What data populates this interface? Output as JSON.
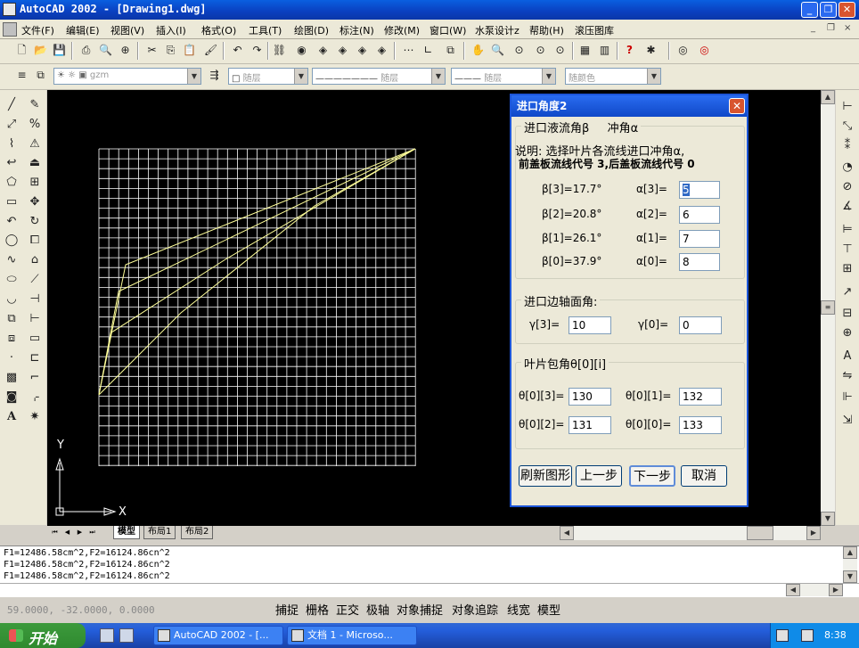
{
  "window": {
    "title": "AutoCAD 2002 - [Drawing1.dwg]",
    "minimize": "_",
    "restore": "❐",
    "close": "✕"
  },
  "menubar": {
    "items": [
      "文件(F)",
      "编辑(E)",
      "视图(V)",
      "插入(I)",
      "格式(O)",
      "工具(T)",
      "绘图(D)",
      "标注(N)",
      "修改(M)",
      "窗口(W)",
      "水泵设计z",
      "帮助(H)",
      "滚压图库"
    ],
    "mdi_controls": [
      "_",
      "❐",
      "×"
    ]
  },
  "toolbar_layer": {
    "layer_name": "gzm",
    "color_combo": "随层",
    "linetype_combo": "随层",
    "lineweight_combo": "随层",
    "plotstyle_combo": "随颜色"
  },
  "layout_tabs": [
    "模型",
    "布局1",
    "布局2"
  ],
  "tab_nav": [
    "⏮",
    "◀",
    "▶",
    "⏭"
  ],
  "command_lines": [
    "F1=12486.58cm^2,F2=16124.86cn^2",
    "F1=12486.58cm^2,F2=16124.86cn^2",
    "F1=12486.58cm^2,F2=16124.86cn^2"
  ],
  "status": {
    "coords": "59.0000, -32.0000, 0.0000",
    "buttons": [
      "捕捉",
      "栅格",
      "正交",
      "极轴",
      "对象捕捉",
      "对象追踪",
      "线宽",
      "模型"
    ]
  },
  "ucs": {
    "x_label": "X",
    "y_label": "Y"
  },
  "taskbar": {
    "start": "开始",
    "tasks": [
      "AutoCAD 2002 - [...",
      "文档 1 - Microso..."
    ],
    "time": "8:38"
  },
  "dialog": {
    "title": "进口角度2",
    "close": "✕",
    "group1_title_a": "进口液流角β",
    "group1_title_b": "冲角α",
    "note_line1": "说明: 选择叶片各流线进口冲角α,",
    "note_line2": "前盖板流线代号 3,后盖板流线代号 0",
    "beta": [
      {
        "label": "β[3]=17.7°",
        "alpha_label": "α[3]=",
        "alpha_value": "5"
      },
      {
        "label": "β[2]=20.8°",
        "alpha_label": "α[2]=",
        "alpha_value": "6"
      },
      {
        "label": "β[1]=26.1°",
        "alpha_label": "α[1]=",
        "alpha_value": "7"
      },
      {
        "label": "β[0]=37.9°",
        "alpha_label": "α[0]=",
        "alpha_value": "8"
      }
    ],
    "group2_title": "进口边轴面角:",
    "gamma3_label": "γ[3]=",
    "gamma3_value": "10",
    "gamma0_label": "γ[0]=",
    "gamma0_value": "0",
    "group3_title": "叶片包角θ[0][i]",
    "theta": [
      {
        "label": "θ[0][3]=",
        "value": "130"
      },
      {
        "label": "θ[0][1]=",
        "value": "132"
      },
      {
        "label": "θ[0][2]=",
        "value": "131"
      },
      {
        "label": "θ[0][0]=",
        "value": "133"
      }
    ],
    "buttons": [
      "刷新图形",
      "上一步",
      "下一步",
      "取消"
    ]
  },
  "colors": {
    "canvas_bg": "#000000",
    "grid": "#ffffff",
    "curve": "#ffff99",
    "title_blue": "#0a47c8"
  }
}
